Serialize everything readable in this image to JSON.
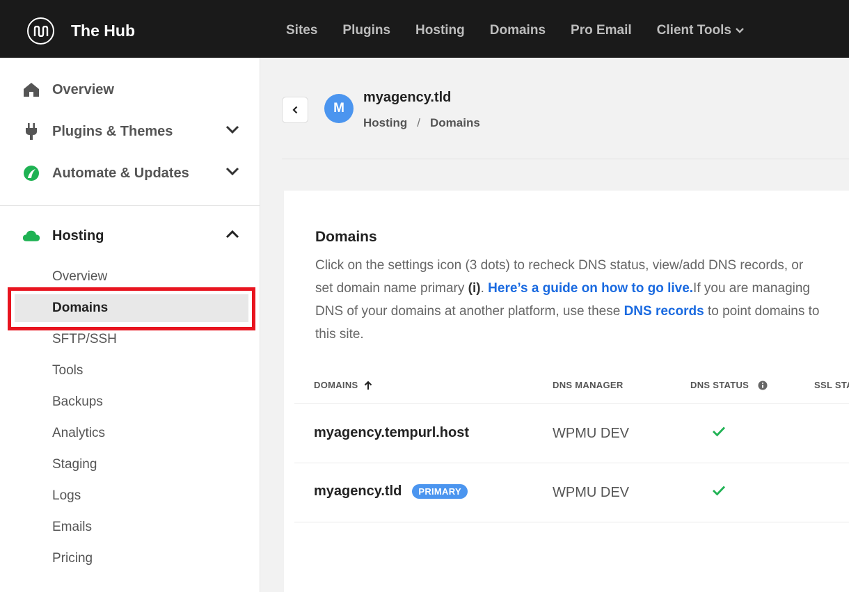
{
  "app": {
    "brand": "The Hub",
    "nav": [
      "Sites",
      "Plugins",
      "Hosting",
      "Domains",
      "Pro Email",
      "Client Tools"
    ]
  },
  "sidebar": {
    "main": [
      {
        "label": "Overview",
        "icon": "home-icon"
      },
      {
        "label": "Plugins & Themes",
        "icon": "plug-icon"
      },
      {
        "label": "Automate & Updates",
        "icon": "automate-icon"
      }
    ],
    "hosting": {
      "label": "Hosting",
      "icon": "cloud-icon",
      "items": [
        "Overview",
        "Domains",
        "SFTP/SSH",
        "Tools",
        "Backups",
        "Analytics",
        "Staging",
        "Logs",
        "Emails",
        "Pricing"
      ],
      "active": "Domains"
    }
  },
  "site": {
    "avatar_letter": "M",
    "name": "myagency.tld",
    "breadcrumb": [
      "Hosting",
      "Domains"
    ],
    "breadcrumb_sep": "/"
  },
  "domains_panel": {
    "title": "Domains",
    "desc_1": "Click on the settings icon (3 dots) to recheck DNS status, view/add DNS records, or set domain name primary ",
    "desc_i": "(i)",
    "desc_2": ". ",
    "guide_link": "Here’s a guide on how to go live.",
    "desc_3": "If you are managing DNS of your domains at another platform, use these ",
    "dns_link": "DNS records",
    "desc_4": " to point domains to this site.",
    "columns": [
      "DOMAINS",
      "DNS MANAGER",
      "DNS STATUS",
      "SSL STA"
    ],
    "rows": [
      {
        "domain": "myagency.tempurl.host",
        "manager": "WPMU DEV",
        "badge": ""
      },
      {
        "domain": "myagency.tld",
        "manager": "WPMU DEV",
        "badge": "PRIMARY"
      }
    ]
  },
  "colors": {
    "topbar": "#1a1a1a",
    "accent_blue": "#4b95ef",
    "link": "#1a6ae0",
    "highlight": "#e8141f",
    "check_green": "#1fb253",
    "cloud_green": "#1fb253"
  }
}
